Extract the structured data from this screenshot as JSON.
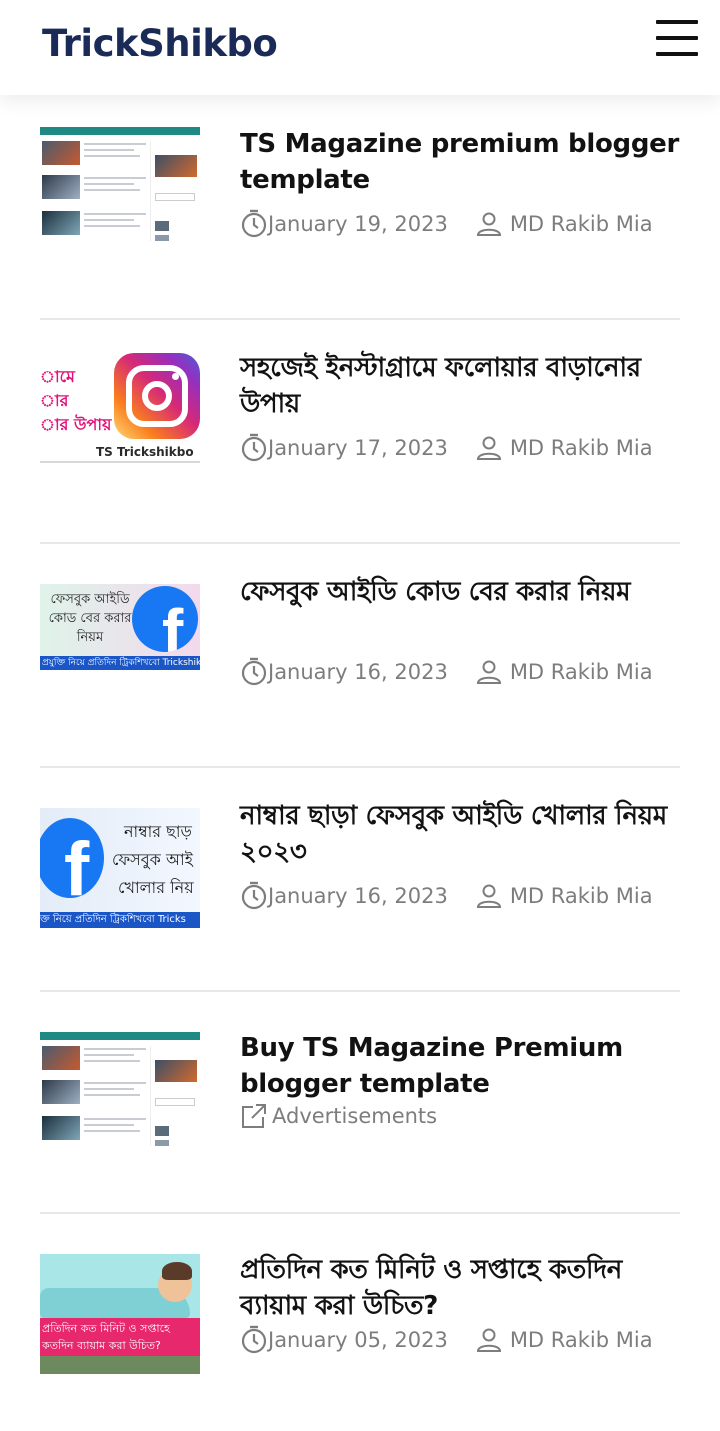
{
  "header": {
    "brand": "TrickShikbo"
  },
  "posts": [
    {
      "title": "TS Magazine premium blogger template",
      "date": "January 19, 2023",
      "author": "MD Rakib Mia",
      "thumb": "blogger-template-screenshot"
    },
    {
      "title": "সহজেই ইনস্টাগ্রামে ফলোয়ার বাড়ানোর উপায়",
      "date": "January 17, 2023",
      "author": "MD Rakib Mia",
      "thumb": "instagram-logo",
      "thumb_text_lines": [
        "ামে",
        "ার",
        "ার উপায়"
      ],
      "thumb_footer": "TS Trickshikbo"
    },
    {
      "title": "ফেসবুক আইডি কোড বের করার নিয়ম",
      "date": "January 16, 2023",
      "author": "MD Rakib Mia",
      "thumb": "facebook-logo",
      "thumb_text_lines": [
        "ফেসবুক আইডি",
        "কোড বের করার",
        "নিয়ম"
      ],
      "thumb_footer": "প্রযুক্তি নিয়ে প্রতিদিন ট্রিকশিখবো Trickshikbo"
    },
    {
      "title": "নাম্বার ছাড়া ফেসবুক আইডি খোলার নিয়ম ২০২৩",
      "date": "January 16, 2023",
      "author": "MD Rakib Mia",
      "thumb": "facebook-logo",
      "thumb_text_lines": [
        "নাম্বার ছাড়",
        "ফেসবুক আই",
        "খোলার নিয়"
      ],
      "thumb_footer": "ক্ত নিয়ে প্রতিদিন ট্রিকশিখবো Tricks"
    },
    {
      "title": "Buy TS Magazine Premium blogger template",
      "label": "Advertisements",
      "thumb": "blogger-template-screenshot"
    },
    {
      "title": "প্রতিদিন কত মিনিট ও সপ্তাহে কতদিন ব্যায়াম করা উচিত?",
      "date": "January 05, 2023",
      "author": "MD Rakib Mia",
      "thumb": "exercise-illustration",
      "thumb_text_lines": [
        "প্রতিদিন কত মিনিট ও সপ্তাহে",
        "কতদিন ব্যায়াম করা উচিত?"
      ]
    }
  ],
  "colors": {
    "brand": "#1b2b57",
    "meta": "#7d7d7d",
    "divider": "#e8e8e8",
    "facebook": "#1877f2",
    "instagram_gradient": [
      "#feda75",
      "#fa7e1e",
      "#d62976",
      "#962fbf",
      "#4f5bd5"
    ]
  }
}
